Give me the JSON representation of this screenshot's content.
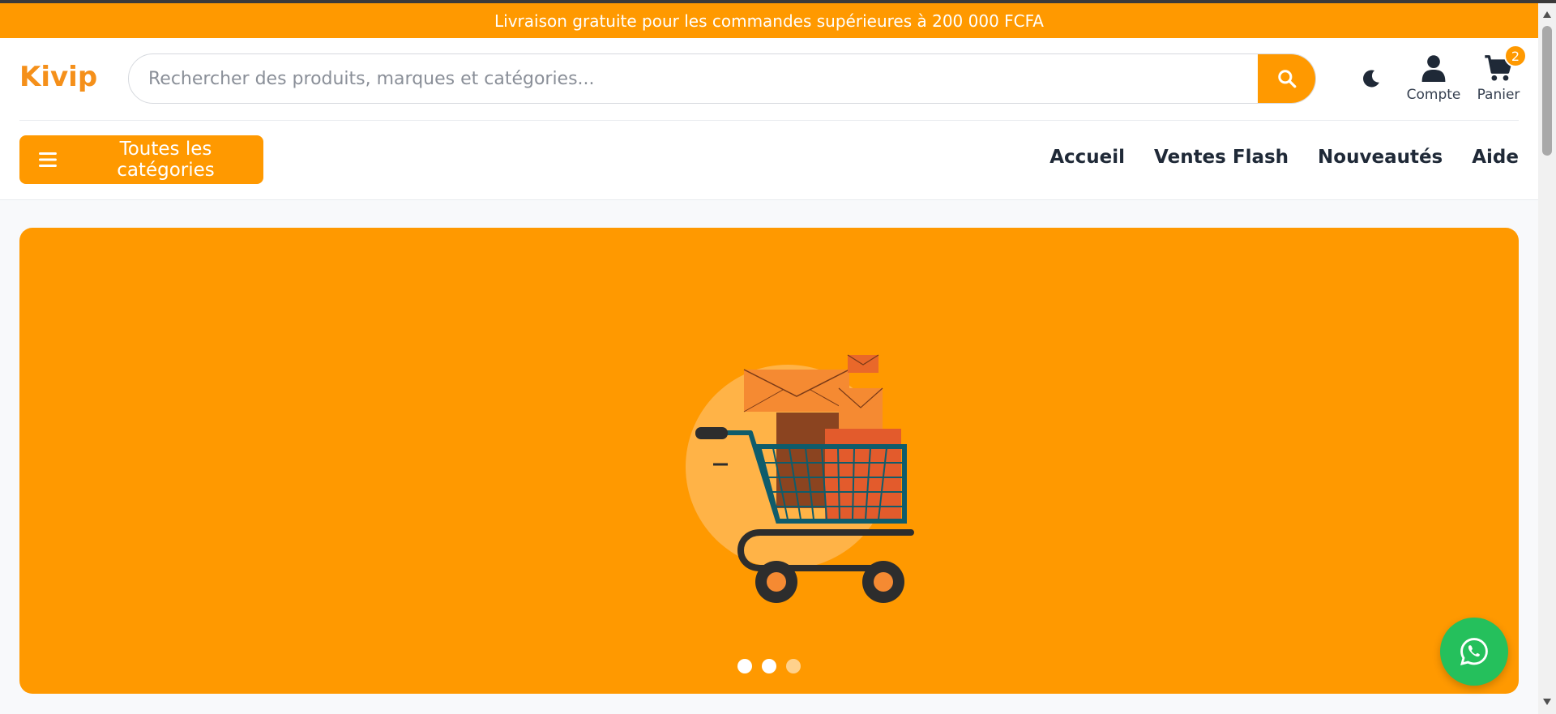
{
  "promo": {
    "text": "Livraison gratuite pour les commandes supérieures à 200 000 FCFA"
  },
  "header": {
    "logo": "Kivip",
    "search": {
      "placeholder": "Rechercher des produits, marques et catégories...",
      "value": ""
    },
    "account_label": "Compte",
    "cart_label": "Panier",
    "cart_count": "2",
    "categories_button": "Toutes les catégories"
  },
  "nav": {
    "items": [
      {
        "label": "Accueil"
      },
      {
        "label": "Ventes Flash"
      },
      {
        "label": "Nouveautés"
      },
      {
        "label": "Aide"
      }
    ]
  },
  "hero": {
    "slides": 3,
    "active_slide": 1
  },
  "icons": {
    "search": "search-icon",
    "theme": "moon-icon",
    "account": "user-icon",
    "cart": "cart-icon",
    "menu": "hamburger-icon",
    "chat": "whatsapp-icon"
  },
  "colors": {
    "accent": "#ff9900",
    "logo": "#f5901a",
    "whatsapp": "#25c05c",
    "text": "#1f2937"
  }
}
